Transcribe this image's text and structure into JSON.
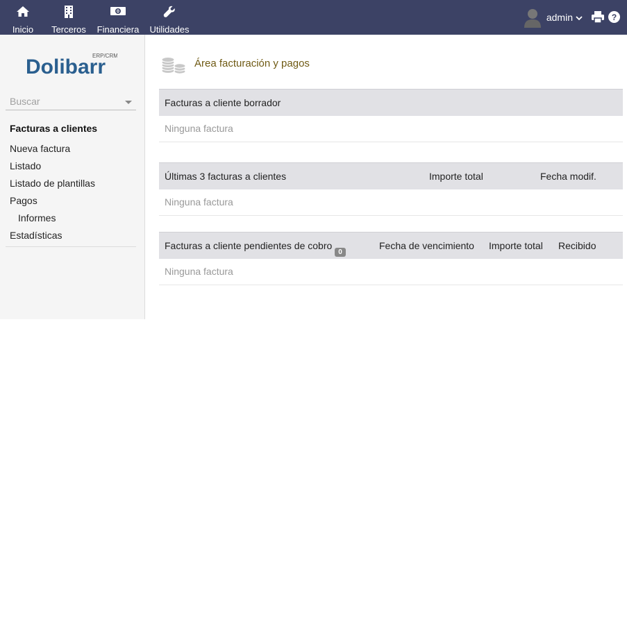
{
  "topmenu": {
    "items": [
      {
        "label": "Inicio",
        "icon": "home-icon"
      },
      {
        "label": "Terceros",
        "icon": "building-icon"
      },
      {
        "label": "Financiera",
        "icon": "money-bill-icon"
      },
      {
        "label": "Utilidades",
        "icon": "wrench-icon"
      }
    ],
    "active": "Financiera",
    "user": "admin"
  },
  "sidebar": {
    "logo_text": "Dolibarr",
    "logo_subtext": "ERP/CRM",
    "search_placeholder": "Buscar",
    "section_title": "Facturas a clientes",
    "links": [
      "Nueva factura",
      "Listado",
      "Listado de plantillas",
      "Pagos",
      "Informes",
      "Estadísticas"
    ]
  },
  "main": {
    "title": "Área facturación y pagos",
    "drafts": {
      "title": "Facturas a cliente borrador",
      "empty": "Ninguna factura"
    },
    "latest": {
      "title": "Últimas 3 facturas a clientes",
      "col_amount": "Importe total",
      "col_date": "Fecha modif.",
      "empty": "Ninguna factura"
    },
    "unpaid": {
      "title": "Facturas a cliente pendientes de cobro",
      "count": "0",
      "col_due": "Fecha de vencimiento",
      "col_amount": "Importe total",
      "col_received": "Recibido",
      "empty": "Ninguna factura"
    }
  },
  "colors": {
    "topbar": "#3c4265",
    "title": "#6f5a14",
    "header_row": "#e1e1e5"
  }
}
